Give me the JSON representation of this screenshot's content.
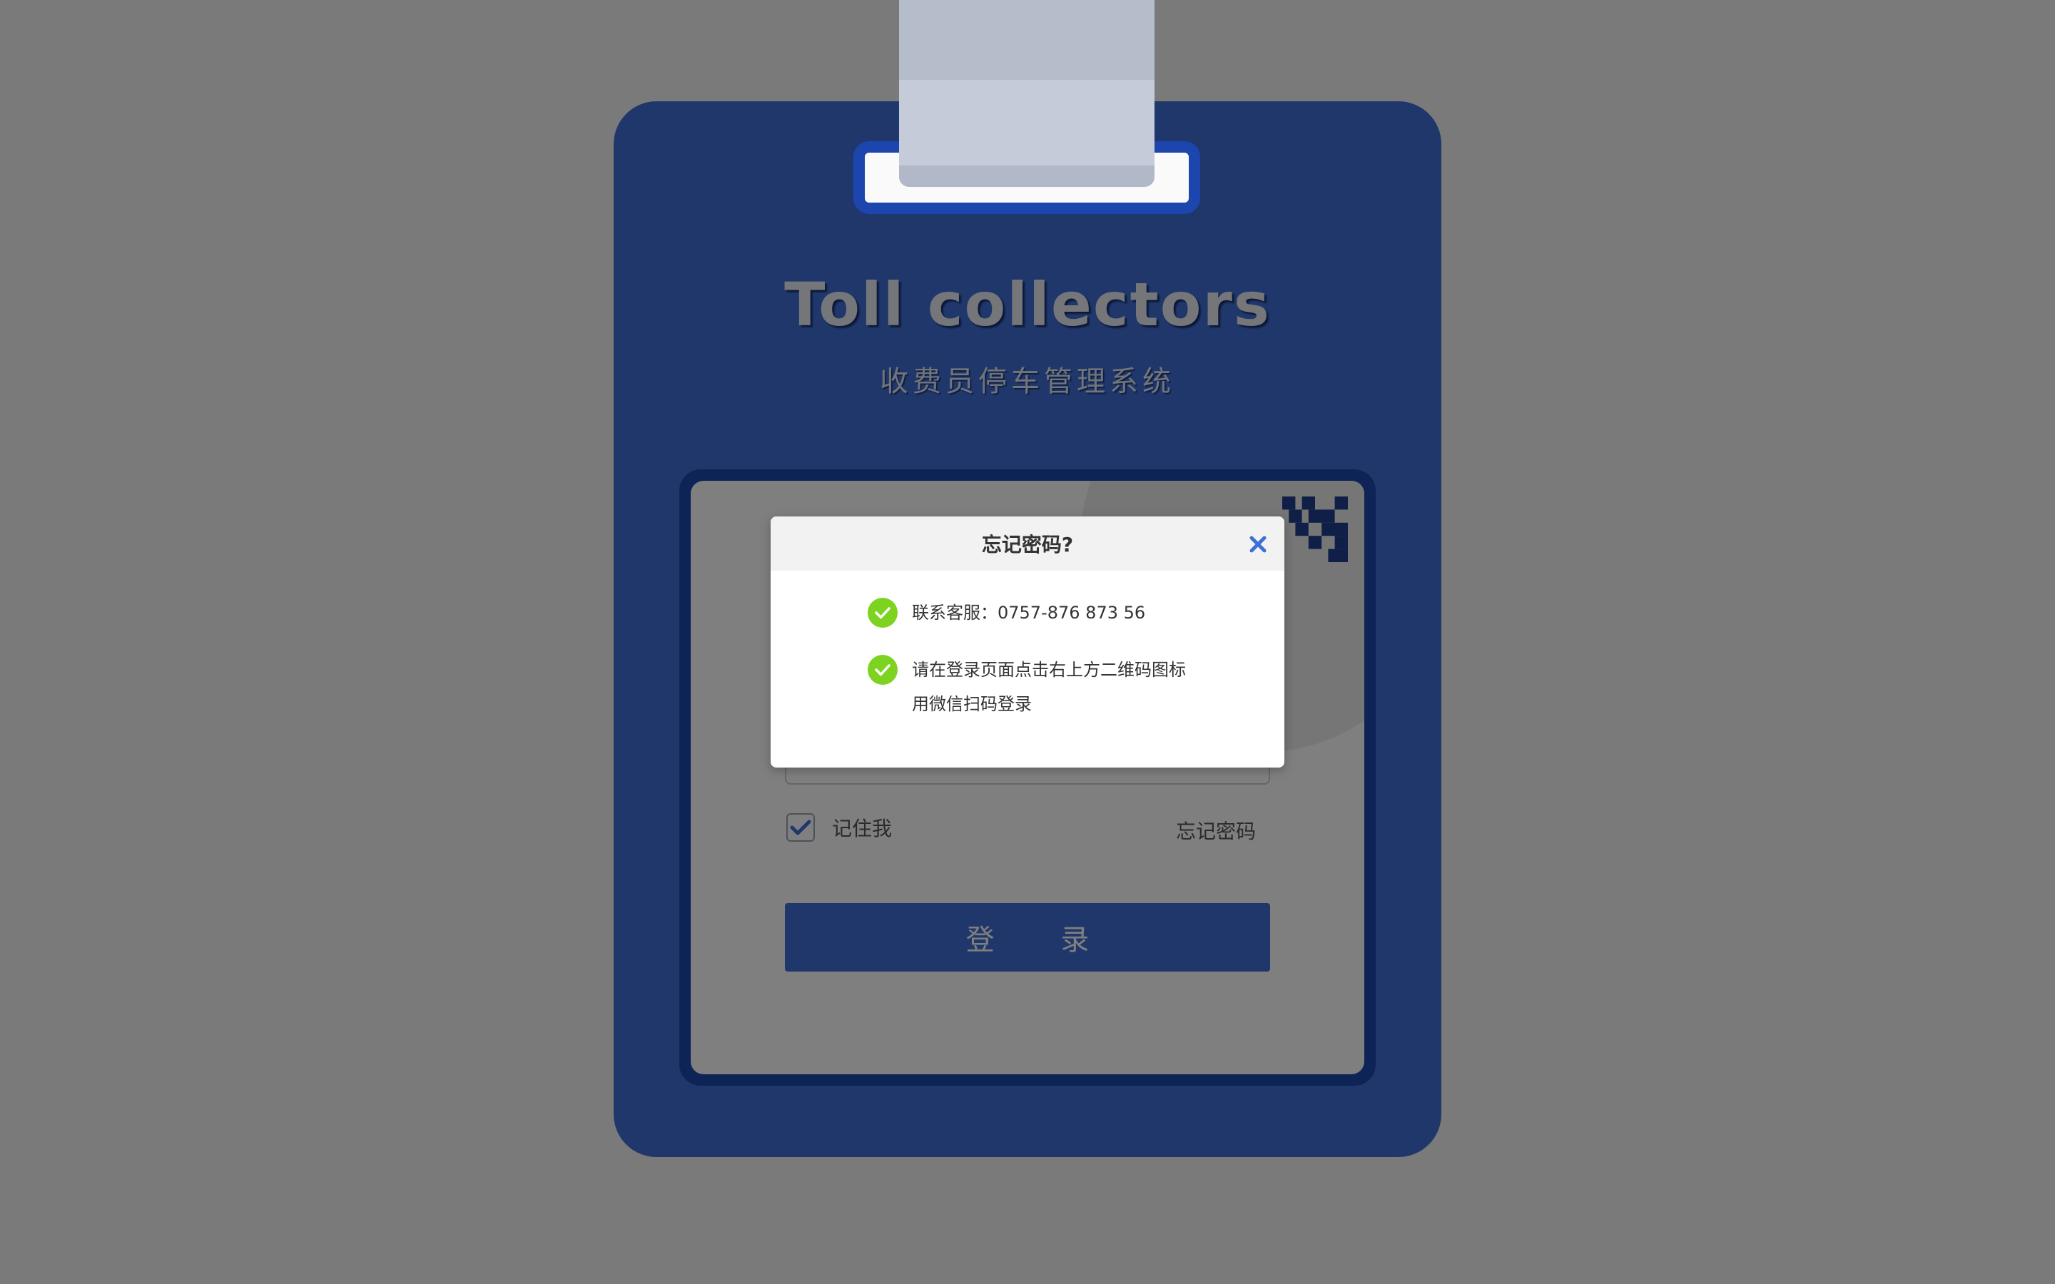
{
  "app": {
    "title": "Toll collectors",
    "subtitle": "收费员停车管理系统"
  },
  "login": {
    "remember_label": "记住我",
    "remember_checked": true,
    "forgot_label": "忘记密码",
    "login_button": "登 录"
  },
  "modal": {
    "title": "忘记密码?",
    "items": [
      {
        "lines": [
          "联系客服：0757-876 873 56"
        ]
      },
      {
        "lines": [
          "请在登录页面点击右上方二维码图标",
          "用微信扫码登录"
        ]
      }
    ],
    "close_icon": "close-icon",
    "check_icon": "check-circle-icon"
  },
  "colors": {
    "card_blue": "#3f6fd6",
    "panel_border": "#1c46ad",
    "check_green": "#7ed321",
    "close_blue": "#3f6fd6"
  }
}
